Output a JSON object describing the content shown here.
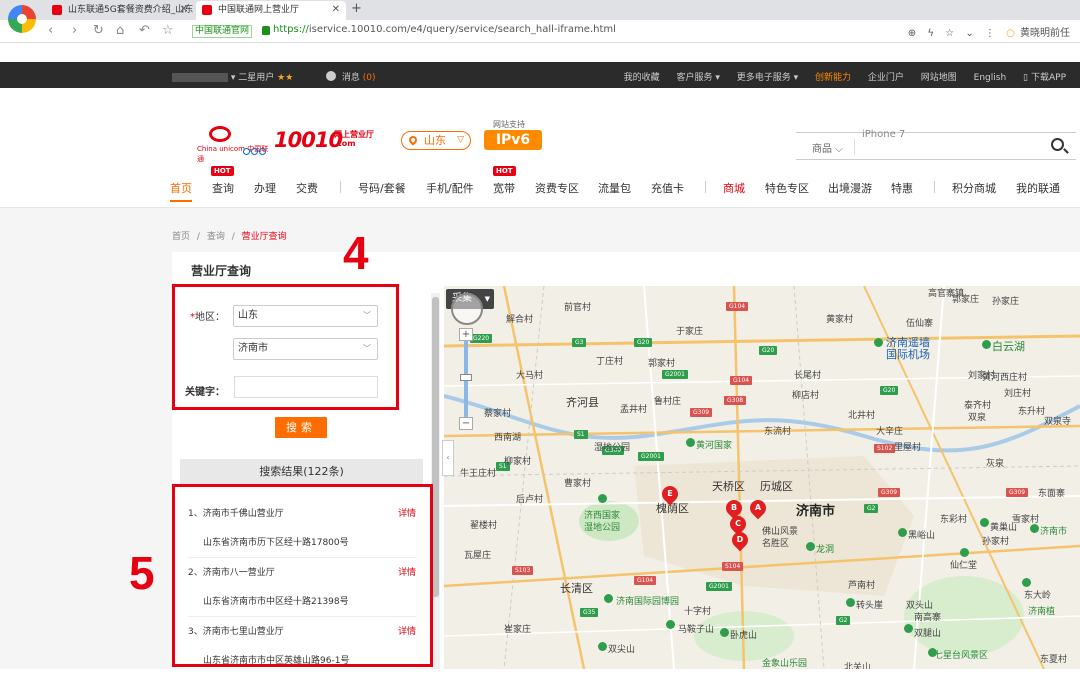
{
  "browser": {
    "tabs": [
      {
        "title": "山东联通5G套餐资费介绍_山东"
      },
      {
        "title": "中国联通网上营业厅"
      }
    ],
    "cert_label": "中国联通官网",
    "url_scheme": "https://",
    "url_rest": "iservice.10010.com/e4/query/service/search_hall-iframe.html",
    "search_hint": "黄晓明前任"
  },
  "sitebar": {
    "user_level": "二星用户",
    "stars": "★★",
    "message_label": "消息",
    "message_count": "(0)",
    "links": [
      "我的收藏",
      "客户服务 ▾",
      "更多电子服务 ▾",
      "创新能力",
      "企业门户",
      "网站地图",
      "English",
      "下载APP"
    ]
  },
  "header": {
    "brand": "10010",
    "brand_sub1": "网上营业厅",
    "brand_sub2": ".com",
    "logo_text": "China unicom 中国联通",
    "region": "山东",
    "ipv6_label": "网站支持",
    "ipv6": "IPv6",
    "search_category": "商品",
    "search_placeholder": "iPhone 7"
  },
  "nav": {
    "items": [
      "首页",
      "查询",
      "办理",
      "交费",
      "号码/套餐",
      "手机/配件",
      "宽带",
      "资费专区",
      "流量包",
      "充值卡",
      "商城",
      "特色专区",
      "出境漫游",
      "特惠",
      "积分商城",
      "我的联通"
    ],
    "hot": "HOT"
  },
  "breadcrumb": [
    "首页",
    "/",
    "查询",
    "/",
    "营业厅查询"
  ],
  "panel": {
    "title": "营业厅查询",
    "region_label": "地区：",
    "required_mark": "*",
    "province": "山东",
    "city": "济南市",
    "keyword_label": "关键字：",
    "search_button": "搜索",
    "results_header": "搜索结果(122条)"
  },
  "results": [
    {
      "name": "1、济南市千佛山营业厅",
      "detail": "详情",
      "address": "山东省济南市历下区经十路17800号"
    },
    {
      "name": "2、济南市八一营业厅",
      "detail": "详情",
      "address": "山东省济南市市中区经十路21398号"
    },
    {
      "name": "3、济南市七里山营业厅",
      "detail": "详情",
      "address": "山东省济南市市中区英雄山路96-1号"
    }
  ],
  "annotations": {
    "box4": "4",
    "box5": "5"
  },
  "map": {
    "type_control": "采集",
    "city_label": "济南市",
    "markers": [
      "A",
      "B",
      "C",
      "D",
      "E"
    ],
    "labels": {
      "l1": "高官寨镇",
      "l2": "伍仙寨",
      "l3": "济南遥墙",
      "l4": "国际机场",
      "l5": "白云湖",
      "l6": "解合村",
      "l7": "前官村",
      "l8": "于家庄",
      "l9": "丁庄村",
      "l10": "大马村",
      "l11": "郭家村",
      "l12": "齐河县",
      "l13": "孟井村",
      "l14": "鲁村庄",
      "l15": "后卢村",
      "l16": "黄河国家",
      "l17": "湿地公园",
      "l18": "济西国家",
      "l19": "湿地公园",
      "l20": "槐荫区",
      "l21": "天桥区",
      "l22": "历城区",
      "l23": "佛山风景",
      "l24": "名胜区",
      "l25": "龙洞",
      "l26": "黑峪山",
      "l27": "仙仁堂",
      "l28": "长清区",
      "l29": "济南国际园博园",
      "l30": "黄巢山",
      "l31": "雪家村",
      "l32": "十字村",
      "l33": "转头崖",
      "l34": "双头山",
      "l35": "南高寨",
      "l36": "马鞍子山",
      "l37": "卧虎山",
      "l38": "双尖山",
      "l39": "双腿山",
      "l40": "东大岭",
      "l41": "金象山乐园",
      "l42": "北关山",
      "l43": "七星台风景区",
      "l44": "东夏村",
      "l45": "孙家庄",
      "l46": "济南市",
      "l47": "黄河西庄村",
      "l48": "刘庄村",
      "l49": "柳店村",
      "l50": "双泉",
      "l51": "北井村",
      "l52": "西南湖",
      "l53": "东彩村",
      "l54": "芦南村",
      "l55": "郭家庄",
      "l56": "济南植",
      "l57": "柳家村",
      "l58": "东流村",
      "l59": "长尾村",
      "l60": "牛王庄村",
      "l61": "瓦屋庄",
      "l62": "灰泉",
      "l63": "刘家村",
      "l64": "黄家村",
      "l65": "大辛庄",
      "l66": "里屋村",
      "l67": "东面寨",
      "l68": "孙家村",
      "l69": "曹家村",
      "l70": "崔家庄",
      "l71": "蔡家村",
      "l72": "泰齐村",
      "l73": "东升村",
      "l74": "双泉寺",
      "l75": "翟楼村"
    },
    "shields": [
      "G104",
      "G20",
      "G3",
      "G20",
      "G220",
      "G2001",
      "G104",
      "G309",
      "G308",
      "S1",
      "G309",
      "G2001",
      "G20",
      "G309",
      "G2",
      "G309",
      "S1",
      "S102",
      "G35",
      "G2001",
      "G104",
      "S103",
      "S104",
      "G2"
    ]
  }
}
